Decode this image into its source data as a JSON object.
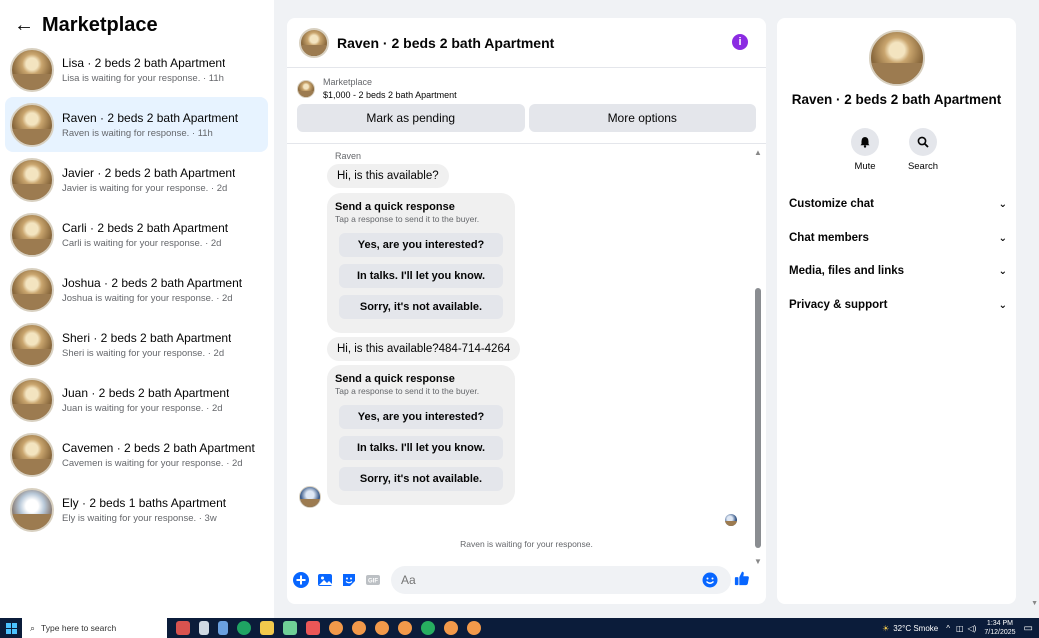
{
  "sidebar": {
    "title": "Marketplace",
    "conversations": [
      {
        "name": "Lisa · 2 beds 2 bath Apartment",
        "preview": "Lisa is waiting for your response. · 11h"
      },
      {
        "name": "Raven · 2 beds 2 bath Apartment",
        "preview": "Raven is waiting for response. · 11h"
      },
      {
        "name": "Javier · 2 beds 2 bath Apartment",
        "preview": "Javier is waiting for your response. · 2d"
      },
      {
        "name": "Carli · 2 beds 2 bath Apartment",
        "preview": "Carli is waiting for your response. · 2d"
      },
      {
        "name": "Joshua · 2 beds 2 bath Apartment",
        "preview": "Joshua is waiting for your response. · 2d"
      },
      {
        "name": "Sheri · 2 beds 2 bath Apartment",
        "preview": "Sheri is waiting for your response. · 2d"
      },
      {
        "name": "Juan · 2 beds 2 bath Apartment",
        "preview": "Juan is waiting for your response. · 2d"
      },
      {
        "name": "Cavemen · 2 beds 2 bath Apartment",
        "preview": "Cavemen is waiting for your response. · 2d"
      },
      {
        "name": "Ely · 2 beds 1 baths Apartment",
        "preview": "Ely is waiting for your response. · 3w"
      }
    ]
  },
  "chat": {
    "title": "Raven · 2 beds 2 bath Apartment",
    "listing_source": "Marketplace",
    "listing_detail": "$1,000 - 2 beds 2 bath Apartment",
    "mark_pending": "Mark as pending",
    "more_options": "More options",
    "sender": "Raven",
    "message1": "Hi, is this available?",
    "message2": "Hi, is this available?484-714-4264",
    "quick_response": {
      "title": "Send a quick response",
      "subtitle": "Tap a response to send it to the buyer.",
      "options": [
        "Yes, are you interested?",
        "In talks. I'll let you know.",
        "Sorry, it's not available."
      ]
    },
    "waiting_note": "Raven is waiting for your response.",
    "input_placeholder": "Aa"
  },
  "info_panel": {
    "name": "Raven · 2 beds 2 bath Apartment",
    "mute_label": "Mute",
    "search_label": "Search",
    "sections": [
      "Customize chat",
      "Chat members",
      "Media, files and links",
      "Privacy & support"
    ]
  },
  "taskbar": {
    "search_placeholder": "Type here to search",
    "weather": "32°C  Smoke",
    "time": "1:34 PM",
    "date": "7/12/2025"
  },
  "colors": {
    "accent": "#0866ff",
    "active_bg": "#e7f3ff",
    "info_purple": "#8b2be2"
  }
}
